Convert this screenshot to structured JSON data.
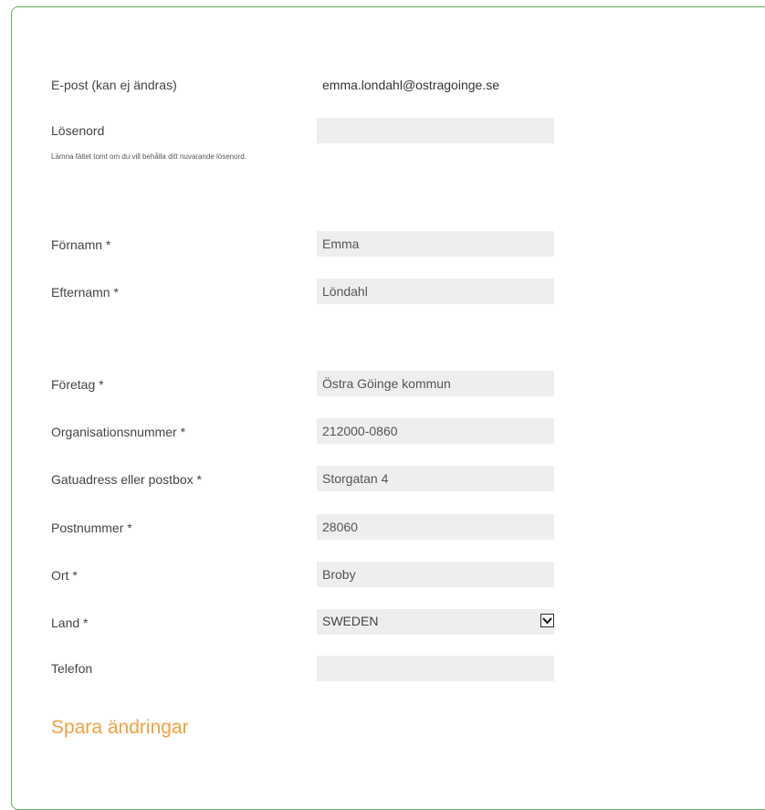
{
  "account": {
    "email_label": "E-post (kan ej ändras)",
    "email_value": "emma.londahl@ostragoinge.se",
    "password_label": "Lösenord",
    "password_value": "",
    "password_hint": "Lämna fältet tomt om du vill behålla ditt nuvarande lösenord."
  },
  "person": {
    "firstname_label": "Förnamn *",
    "firstname_value": "Emma",
    "lastname_label": "Efternamn *",
    "lastname_value": "Löndahl"
  },
  "company": {
    "company_label": "Företag *",
    "company_value": "Östra Göinge kommun",
    "orgnr_label": "Organisationsnummer *",
    "orgnr_value": "212000-0860",
    "address_label": "Gatuadress eller postbox *",
    "address_value": "Storgatan 4",
    "zip_label": "Postnummer *",
    "zip_value": "28060",
    "city_label": "Ort *",
    "city_value": "Broby",
    "country_label": "Land *",
    "country_value": "SWEDEN",
    "phone_label": "Telefon",
    "phone_value": ""
  },
  "actions": {
    "save_label": "Spara ändringar"
  },
  "colors": {
    "panel_border": "#5fb35f",
    "field_background": "#eeeeee",
    "save_link": "#f0a040"
  }
}
